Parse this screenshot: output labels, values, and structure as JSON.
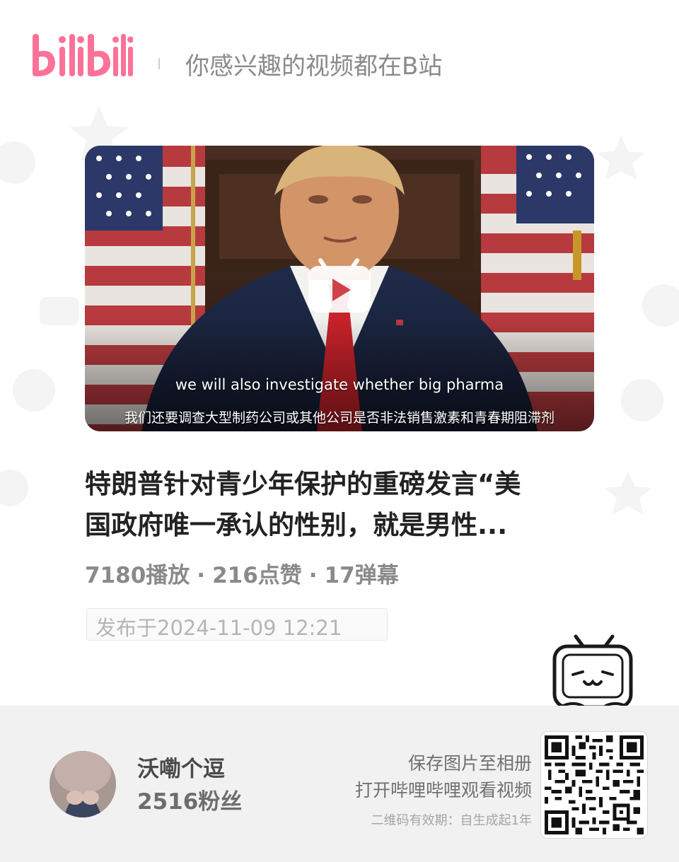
{
  "header": {
    "logo_text": "bilibili",
    "slogan": "你感兴趣的视频都在B站"
  },
  "video": {
    "subtitle_en": "we will also investigate whether big pharma",
    "subtitle_zh": "我们还要调查大型制药公司或其他公司是否非法销售激素和青春期阻滞剂",
    "play_icon": "bilibili-tv-play-icon"
  },
  "title": {
    "line1": "特朗普针对青少年保护的重磅发言“美",
    "line2": "国政府唯一承认的性别，就是男性..."
  },
  "stats": {
    "plays": "7180播放",
    "likes": "216点赞",
    "danmaku": "17弹幕",
    "separator": "·"
  },
  "publish": {
    "text": "发布于2024-11-09 12:21"
  },
  "author": {
    "name": "沃嘞个逗",
    "fans": "2516粉丝"
  },
  "share": {
    "line1": "保存图片至相册",
    "line2": "打开哔哩哔哩观看视频",
    "validity": "二维码有效期：自生成起1年"
  },
  "colors": {
    "brand_pink": "#fb7299",
    "footer_bg": "#f1f1f2",
    "tie_red": "#c8222a"
  }
}
